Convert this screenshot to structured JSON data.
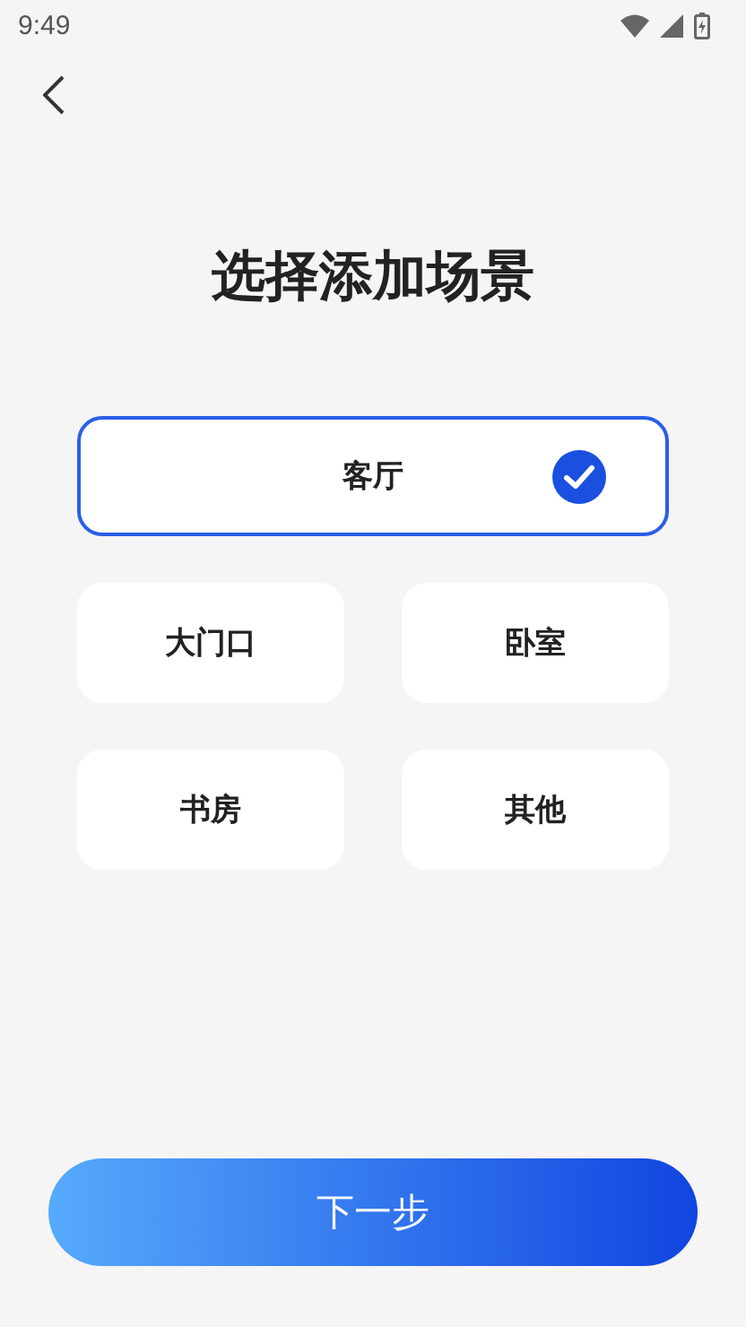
{
  "status_bar": {
    "time": "9:49"
  },
  "title": "选择添加场景",
  "scenes": [
    {
      "label": "客厅",
      "selected": true
    },
    {
      "label": "大门口",
      "selected": false
    },
    {
      "label": "卧室",
      "selected": false
    },
    {
      "label": "书房",
      "selected": false
    },
    {
      "label": "其他",
      "selected": false
    }
  ],
  "next_button": "下一步"
}
